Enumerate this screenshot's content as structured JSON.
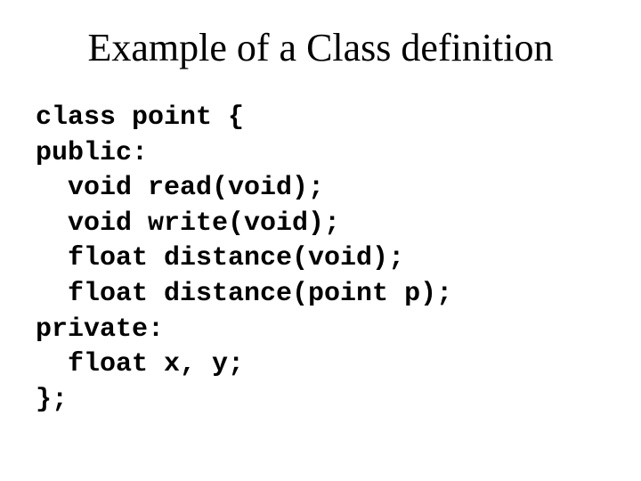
{
  "title": "Example of a Class definition",
  "code": {
    "l1": "class point {",
    "l2": "public:",
    "l3": "  void read(void);",
    "l4": "  void write(void);",
    "l5": "  float distance(void);",
    "l6": "  float distance(point p);",
    "l7": "private:",
    "l8": "  float x, y;",
    "l9": "};"
  }
}
